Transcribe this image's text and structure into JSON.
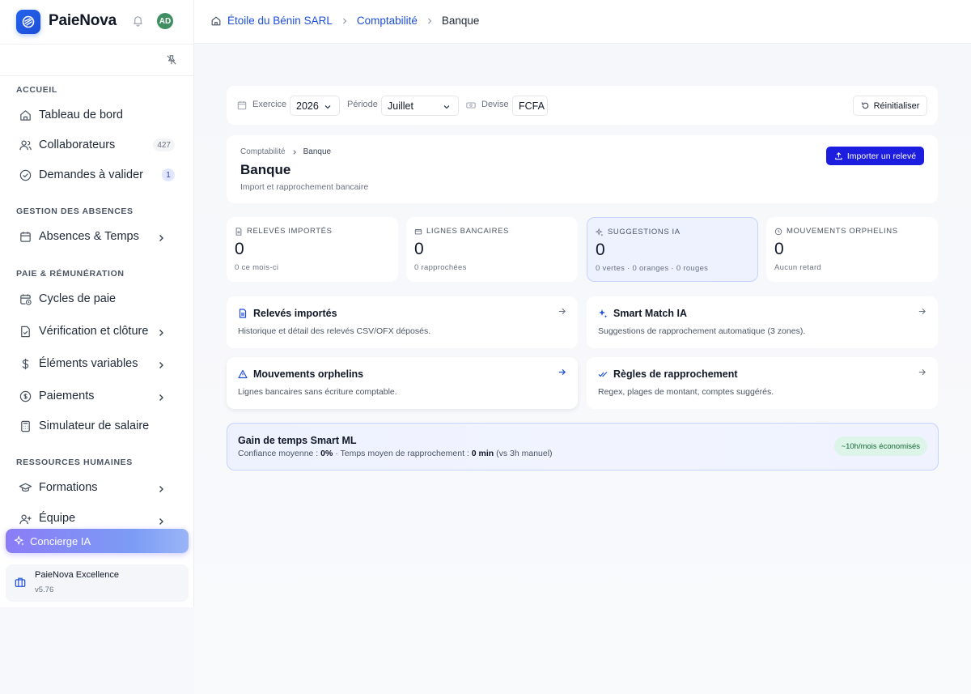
{
  "app": {
    "name": "PaieNova",
    "avatar_initials": "AD",
    "brand_color": "#2563eb"
  },
  "breadcrumb": [
    "Étoile du Bénin SARL",
    "Comptabilité",
    "Banque"
  ],
  "sidebar": {
    "sections": [
      {
        "label": "ACCUEIL"
      },
      {
        "label": "GESTION DES ABSENCES"
      },
      {
        "label": "PAIE & RÉMUNÉRATION"
      },
      {
        "label": "RESSOURCES HUMAINES"
      }
    ],
    "items": [
      {
        "label": "Tableau de bord",
        "icon": "home-icon"
      },
      {
        "label": "Collaborateurs",
        "icon": "users-icon",
        "badge": "427"
      },
      {
        "label": "Demandes à valider",
        "icon": "check-circle-icon",
        "badge": "1"
      },
      {
        "label": "Absences & Temps",
        "icon": "calendar-icon"
      },
      {
        "label": "Cycles de paie",
        "icon": "calendar-clock-icon"
      },
      {
        "label": "Vérification et clôture",
        "icon": "file-check-icon"
      },
      {
        "label": "Éléments variables",
        "icon": "dollar-icon"
      },
      {
        "label": "Paiements",
        "icon": "coin-icon"
      },
      {
        "label": "Simulateur de salaire",
        "icon": "calculator-icon"
      },
      {
        "label": "Formations",
        "icon": "graduation-cap-icon"
      },
      {
        "label": "Équipe",
        "icon": "user-plus-icon"
      }
    ],
    "concierge_label": "Concierge IA",
    "footer": {
      "title": "PaieNova Excellence",
      "version": "v5.76"
    }
  },
  "filters": {
    "exercice_label": "Exercice",
    "exercice_value": "2026",
    "periode_label": "Période",
    "periode_value": "Juillet",
    "devise_label": "Devise",
    "devise_value": "FCFA",
    "reset_label": "Réinitialiser"
  },
  "page": {
    "crumb_parent": "Comptabilité",
    "crumb_current": "Banque",
    "title": "Banque",
    "subtitle": "Import et rapprochement bancaire",
    "import_button": "Importer un relevé"
  },
  "stats": [
    {
      "label": "RELEVÉS IMPORTÉS",
      "value": "0",
      "sub": "0 ce mois-ci"
    },
    {
      "label": "LIGNES BANCAIRES",
      "value": "0",
      "sub": "0 rapprochées"
    },
    {
      "label": "SUGGESTIONS IA",
      "value": "0",
      "sub": "0 vertes · 0 oranges · 0 rouges"
    },
    {
      "label": "MOUVEMENTS ORPHELINS",
      "value": "0",
      "sub": "Aucun retard"
    }
  ],
  "cards": [
    {
      "title": "Relevés importés",
      "desc": "Historique et détail des relevés CSV/OFX déposés."
    },
    {
      "title": "Smart Match IA",
      "desc": "Suggestions de rapprochement automatique (3 zones)."
    },
    {
      "title": "Mouvements orphelins",
      "desc": "Lignes bancaires sans écriture comptable."
    },
    {
      "title": "Règles de rapprochement",
      "desc": "Regex, plages de montant, comptes suggérés."
    }
  ],
  "banner": {
    "title": "Gain de temps Smart ML",
    "confidence_label": "Confiance moyenne :",
    "confidence_value": "0%",
    "time_label": "· Temps moyen de rapprochement :",
    "time_value": "0 min",
    "time_note": "(vs 3h manuel)",
    "pill": "~10h/mois économisés"
  }
}
